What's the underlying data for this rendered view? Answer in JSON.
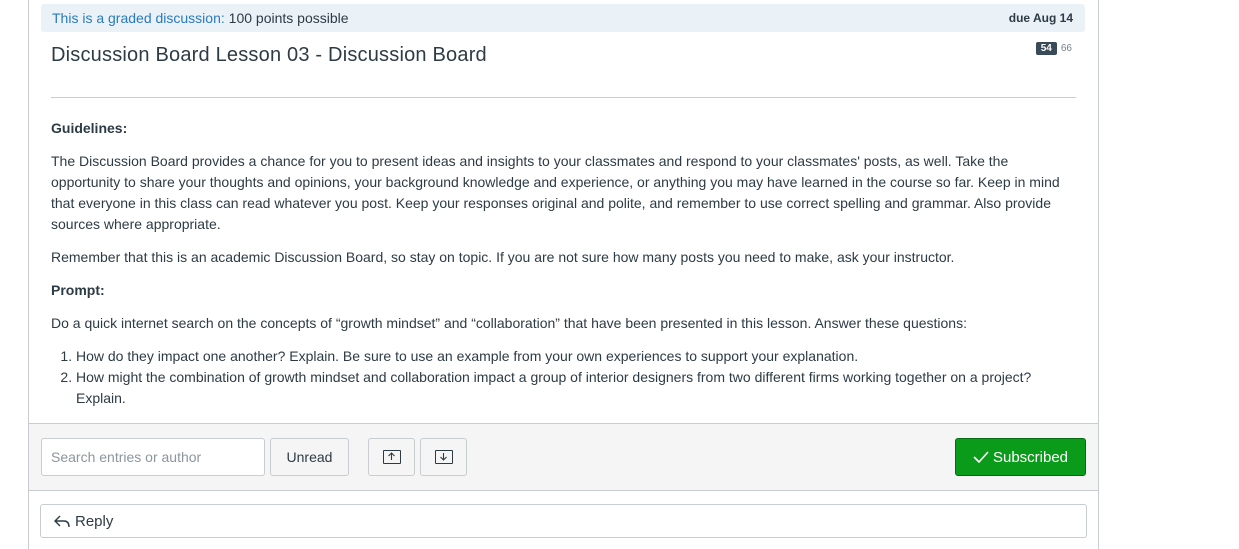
{
  "assignment": {
    "graded_label": "This is a graded discussion:",
    "points": "100 points possible",
    "due": "due Aug 14"
  },
  "discussion": {
    "title": "Discussion Board Lesson 03 - Discussion Board",
    "unread_count": "54",
    "total_count": "66"
  },
  "content": {
    "guidelines_heading": "Guidelines:",
    "guidelines_p1": "The Discussion Board provides a chance for you to present ideas and insights to your classmates and respond to your classmates' posts, as well. Take the opportunity to share your thoughts and opinions, your background knowledge and experience, or anything you may have learned in the course so far. Keep in mind that everyone in this class can read whatever you post. Keep your responses original and polite, and remember to use correct spelling and grammar. Also provide sources where appropriate.",
    "guidelines_p2": "Remember that this is an academic Discussion Board, so stay on topic. If you are not sure how many posts you need to make, ask your instructor.",
    "prompt_heading": "Prompt:",
    "prompt_intro": "Do a quick internet search on the concepts of “growth mindset” and “collaboration” that have been presented in this lesson. Answer these questions:",
    "questions": [
      "How do they impact one another? Explain. Be sure to use an example from your own experiences to support your explanation.",
      "How might the combination of growth mindset and collaboration impact a group of interior designers from two different firms working together on a project? Explain."
    ]
  },
  "toolbar": {
    "search_placeholder": "Search entries or author",
    "unread_label": "Unread",
    "subscribed_label": "Subscribed"
  },
  "reply": {
    "label": "Reply"
  },
  "icons": {
    "collapse": "collapse-all-icon",
    "expand": "expand-all-icon",
    "check": "check-icon",
    "reply": "reply-arrow-icon"
  },
  "colors": {
    "accent_link": "#2a7abc",
    "subscribed_green": "#0b9b1b",
    "graded_bg": "#eaf2f8"
  }
}
